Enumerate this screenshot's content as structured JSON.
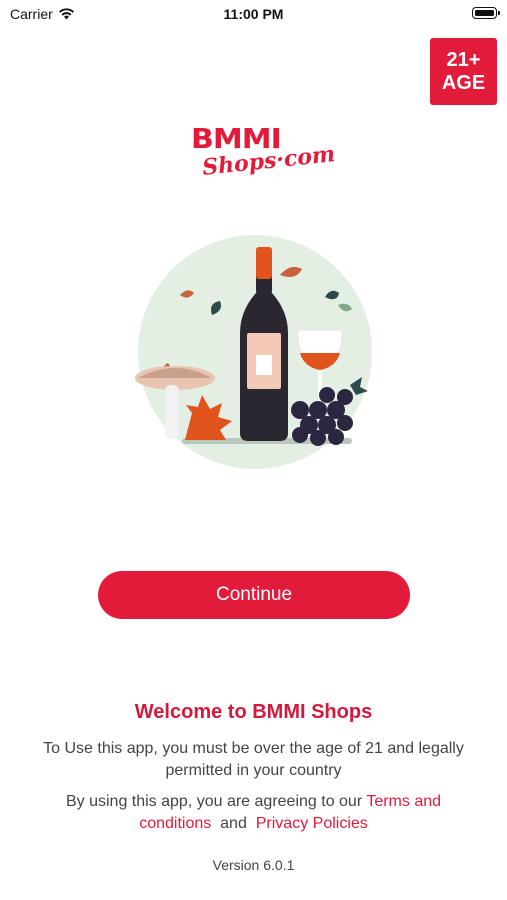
{
  "status_bar": {
    "carrier": "Carrier",
    "time": "11:00 PM"
  },
  "age_badge": {
    "line1": "21+",
    "line2": "AGE"
  },
  "logo": {
    "line1": "BMMI",
    "line2": "Shops·com"
  },
  "continue_label": "Continue",
  "welcome_title": "Welcome to BMMI Shops",
  "description": "To Use this app, you must be over the age of 21 and legally permitted in your country",
  "agreement": {
    "prefix": "By using this app, you are agreeing to our",
    "terms_link": "Terms and conditions",
    "joiner": "and",
    "privacy_link": "Privacy Policies"
  },
  "version": "Version 6.0.1",
  "colors": {
    "brand_red": "#e31b3b",
    "illustration_bg": "#e3efe3"
  }
}
